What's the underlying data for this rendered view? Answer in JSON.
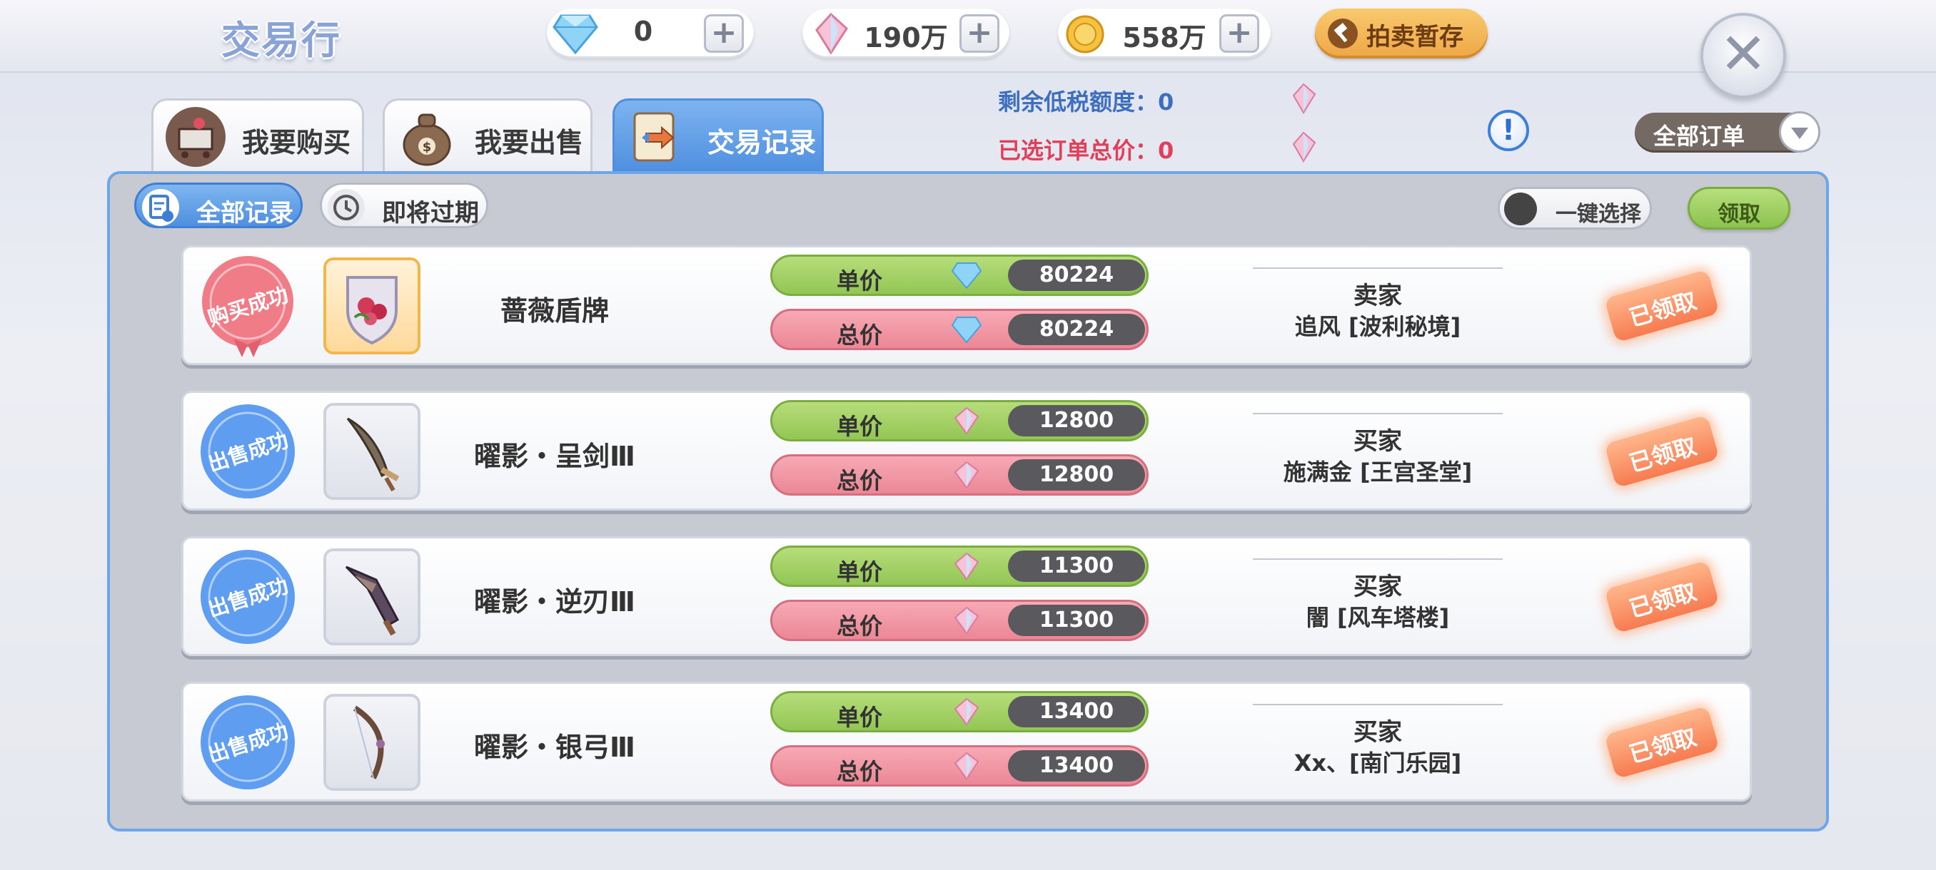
{
  "header": {
    "title": "交易行",
    "resources": [
      {
        "name": "diamond",
        "icon": "diamond-icon",
        "value": "0"
      },
      {
        "name": "crystal",
        "icon": "crystal-feather-icon",
        "value": "190万"
      },
      {
        "name": "gold",
        "icon": "gold-coin-icon",
        "value": "558万"
      }
    ],
    "auction_button": "拍卖暂存",
    "close_label": "✕"
  },
  "tabs": [
    {
      "label": "我要购买",
      "icon": "shopping-cart-icon",
      "active": false
    },
    {
      "label": "我要出售",
      "icon": "money-bag-icon",
      "active": false
    },
    {
      "label": "交易记录",
      "icon": "trade-record-icon",
      "active": true
    }
  ],
  "info": {
    "tax_free_quota": "剩余低税额度：0",
    "selected_total": "已选订单总价：0"
  },
  "order_filter": "全部订单",
  "subtabs": [
    {
      "label": "全部记录",
      "icon": "records-icon",
      "active": true
    },
    {
      "label": "即将过期",
      "icon": "clock-history-icon",
      "active": false
    }
  ],
  "one_click_select": "一键选择",
  "claim_button": "领取",
  "unit_price_label": "单价",
  "total_price_label": "总价",
  "records": [
    {
      "status": "购买成功",
      "status_color": "#f07c88",
      "item_name": "蔷薇盾牌",
      "item_icon": "rose-shield-icon",
      "currency": "diamond",
      "unit_price": "80224",
      "total_price": "80224",
      "role": "卖家",
      "counterparty": "追风 [波利秘境]",
      "claimed": "已领取"
    },
    {
      "status": "出售成功",
      "status_color": "#5f9df0",
      "item_name": "曜影・呈剑Ⅲ",
      "item_icon": "curved-sword-icon",
      "currency": "crystal",
      "unit_price": "12800",
      "total_price": "12800",
      "role": "买家",
      "counterparty": "施满金 [王宫圣堂]",
      "claimed": "已领取"
    },
    {
      "status": "出售成功",
      "status_color": "#5f9df0",
      "item_name": "曜影・逆刃Ⅲ",
      "item_icon": "reverse-blade-icon",
      "currency": "crystal",
      "unit_price": "11300",
      "total_price": "11300",
      "role": "买家",
      "counterparty": "闇 [风车塔楼]",
      "claimed": "已领取"
    },
    {
      "status": "出售成功",
      "status_color": "#5f9df0",
      "item_name": "曜影・银弓Ⅲ",
      "item_icon": "silver-bow-icon",
      "currency": "crystal",
      "unit_price": "13400",
      "total_price": "13400",
      "role": "买家",
      "counterparty": "Xx、[南门乐园]",
      "claimed": "已领取"
    }
  ]
}
